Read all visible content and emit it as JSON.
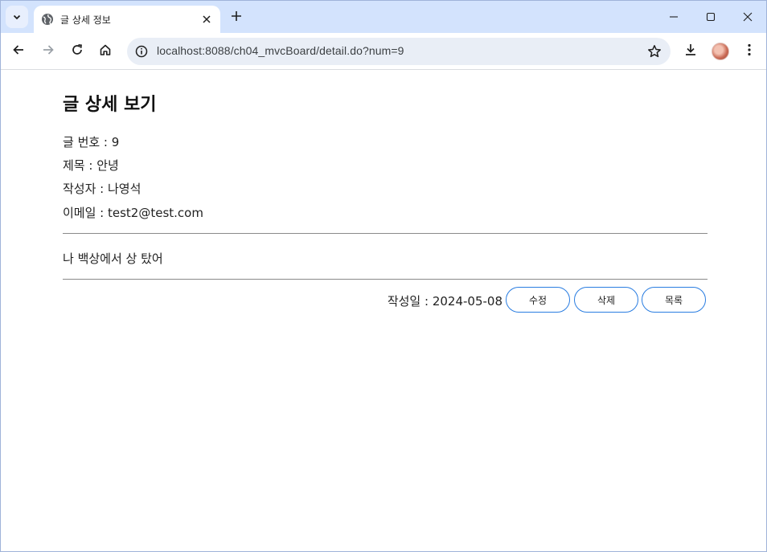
{
  "browser": {
    "tab_title": "글 상세 정보",
    "url": "localhost:8088/ch04_mvcBoard/detail.do?num=9",
    "icons": {
      "tab_search": "chevron-down-icon",
      "favicon": "globe-icon",
      "tab_close": "close-icon",
      "new_tab": "plus-icon",
      "minimize": "minimize-icon",
      "maximize": "maximize-icon",
      "close_window": "close-icon",
      "back": "back-arrow-icon",
      "forward": "forward-arrow-icon",
      "reload": "reload-icon",
      "home": "home-icon",
      "site_info": "info-icon",
      "bookmark": "star-icon",
      "download": "download-icon",
      "menu": "kebab-menu-icon"
    }
  },
  "page": {
    "heading": "글 상세 보기",
    "fields": [
      {
        "text": "글 번호 : 9"
      },
      {
        "text": "제목 : 안녕"
      },
      {
        "text": "작성자 : 나영석"
      },
      {
        "text": "이메일 : test2@test.com"
      }
    ],
    "body": "나 백상에서 상 탔어",
    "date": "작성일 : 2024-05-08",
    "buttons": {
      "edit": "수정",
      "delete": "삭제",
      "list": "목록"
    },
    "colors": {
      "button_border": "#2a7de1",
      "divider": "#8a8a8a"
    }
  }
}
